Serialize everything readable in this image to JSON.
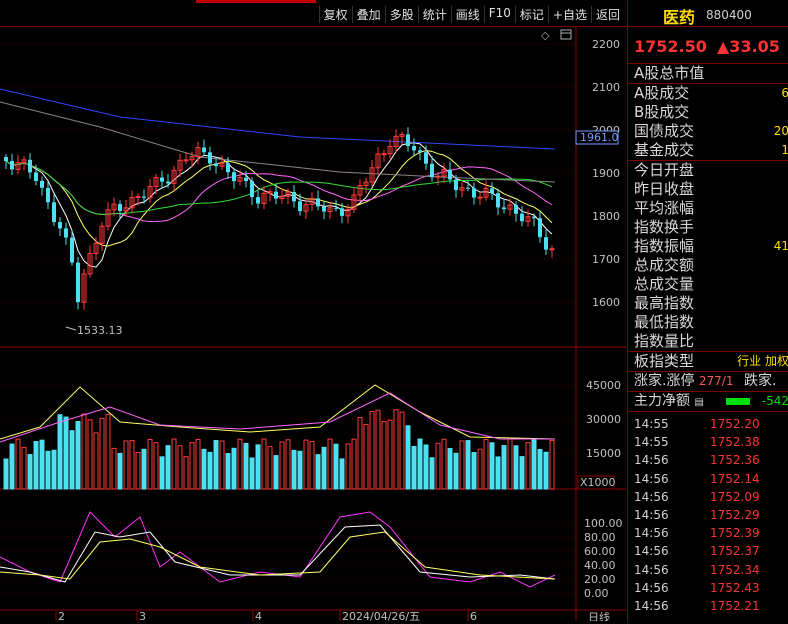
{
  "toolbar": {
    "items": [
      "复权",
      "叠加",
      "多股",
      "统计",
      "画线",
      "F10",
      "标记",
      "+自选",
      "返回"
    ]
  },
  "kline": {
    "price_labels": [
      "2200",
      "2100",
      "2000",
      "1900",
      "1800",
      "1700",
      "1600"
    ],
    "current_tag": "1961.0",
    "low_label": "1533.13",
    "vol_labels": [
      "45000",
      "30000",
      "15000"
    ],
    "vol_unit": "X1000",
    "kdj_labels": [
      "100.00",
      "80.00",
      "60.00",
      "40.00",
      "20.00",
      "0.00"
    ],
    "x_labels": [
      "2",
      "3",
      "4",
      "2024/04/26/五",
      "6"
    ],
    "period_label": "日线"
  },
  "quote": {
    "name": "医药",
    "code": "880400",
    "price": "1752.50",
    "change": "▲33.05",
    "stats": [
      {
        "label": "A股总市值",
        "value": ""
      },
      {
        "label": "A股成交",
        "value": "6"
      },
      {
        "label": "B股成交",
        "value": ""
      },
      {
        "label": "国债成交",
        "value": "20"
      },
      {
        "label": "基金成交",
        "value": "1"
      },
      {
        "label": "今日开盘",
        "value": ""
      },
      {
        "label": "昨日收盘",
        "value": ""
      },
      {
        "label": "平均涨幅",
        "value": ""
      },
      {
        "label": "指数换手",
        "value": ""
      },
      {
        "label": "指数振幅",
        "value": "41"
      },
      {
        "label": "总成交额",
        "value": ""
      },
      {
        "label": "总成交量",
        "value": ""
      },
      {
        "label": "最高指数",
        "value": ""
      },
      {
        "label": "最低指数",
        "value": ""
      },
      {
        "label": "指数量比",
        "value": ""
      },
      {
        "label": "板指类型",
        "value": "行业 加权"
      }
    ],
    "updown": {
      "label": "涨家.涨停",
      "value": "277/1",
      "label2": "跌家."
    },
    "mainflow": {
      "label": "主力净额",
      "value": "-542"
    },
    "ticks": [
      {
        "time": "14:55",
        "price": "1752.20"
      },
      {
        "time": "14:55",
        "price": "1752.38"
      },
      {
        "time": "14:56",
        "price": "1752.36"
      },
      {
        "time": "14:56",
        "price": "1752.14"
      },
      {
        "time": "14:56",
        "price": "1752.09"
      },
      {
        "time": "14:56",
        "price": "1752.29"
      },
      {
        "time": "14:56",
        "price": "1752.39"
      },
      {
        "time": "14:56",
        "price": "1752.37"
      },
      {
        "time": "14:56",
        "price": "1752.34"
      },
      {
        "time": "14:56",
        "price": "1752.43"
      },
      {
        "time": "14:56",
        "price": "1752.21"
      }
    ]
  }
}
